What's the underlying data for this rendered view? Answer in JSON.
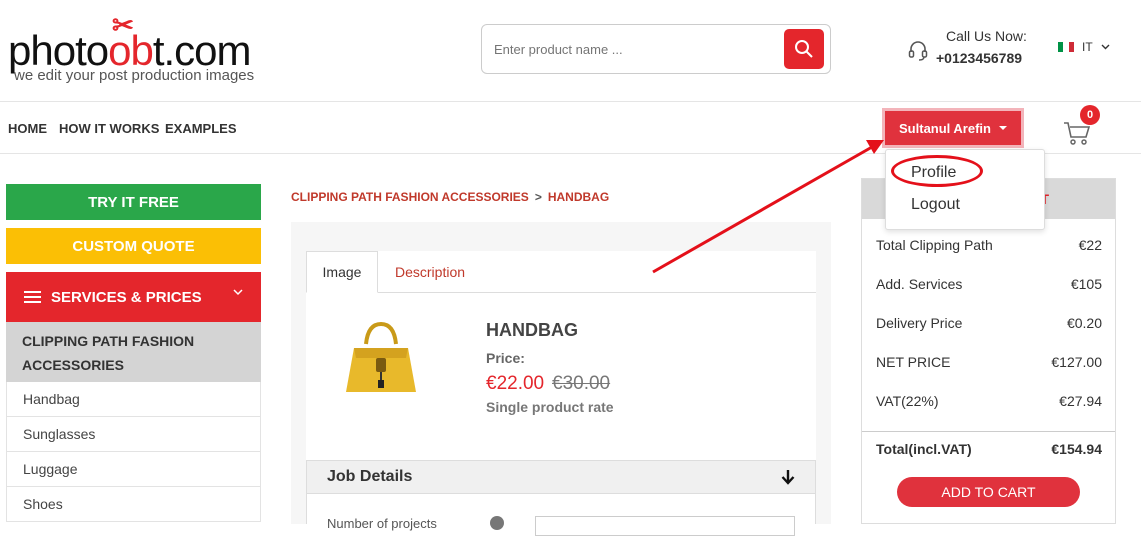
{
  "header": {
    "logo_text": "photo",
    "logo_text_end": "t.com",
    "logo_tagline": "we edit your post production images",
    "search_placeholder": "Enter product name ...",
    "call_label": "Call Us Now:",
    "call_number": "+0123456789",
    "language": "IT",
    "flag_colors": [
      "#009246",
      "#ffffff",
      "#ce2b37"
    ]
  },
  "nav": {
    "links": [
      "HOME",
      "HOW IT WORKS",
      "EXAMPLES"
    ],
    "user_name": "Sultanul Arefin",
    "cart_count": "0"
  },
  "user_menu": {
    "items": [
      "Profile",
      "Logout"
    ]
  },
  "sidebar": {
    "try_free": "TRY IT FREE",
    "custom_quote": "CUSTOM QUOTE",
    "services": "SERVICES & PRICES",
    "category": "CLIPPING PATH FASHION ACCESSORIES",
    "items": [
      "Handbag",
      "Sunglasses",
      "Luggage",
      "Shoes"
    ]
  },
  "breadcrumb": {
    "parent": "CLIPPING PATH FASHION ACCESSORIES",
    "separator": ">",
    "current": "HANDBAG"
  },
  "product": {
    "tabs": [
      "Image",
      "Description"
    ],
    "title": "HANDBAG",
    "price_label": "Price:",
    "price": "€22.00",
    "old_price": "€30.00",
    "rate_note": "Single product rate"
  },
  "job": {
    "title": "Job Details",
    "first_field_label": "Number of projects"
  },
  "summary": {
    "head_partial": "T",
    "rows": [
      {
        "label": "Total Clipping Path",
        "value": "€22"
      },
      {
        "label": "Add. Services",
        "value": "€105"
      },
      {
        "label": "Delivery Price",
        "value": "€0.20"
      },
      {
        "label": "NET PRICE",
        "value": "€127.00"
      },
      {
        "label": "VAT(22%)",
        "value": "€27.94"
      }
    ],
    "total_label": "Total(incl.VAT)",
    "total_value": "€154.94",
    "add_to_cart": "ADD TO CART"
  },
  "colors": {
    "brand_red": "#e4262c",
    "green": "#2aa74a",
    "yellow": "#fbbf05"
  }
}
